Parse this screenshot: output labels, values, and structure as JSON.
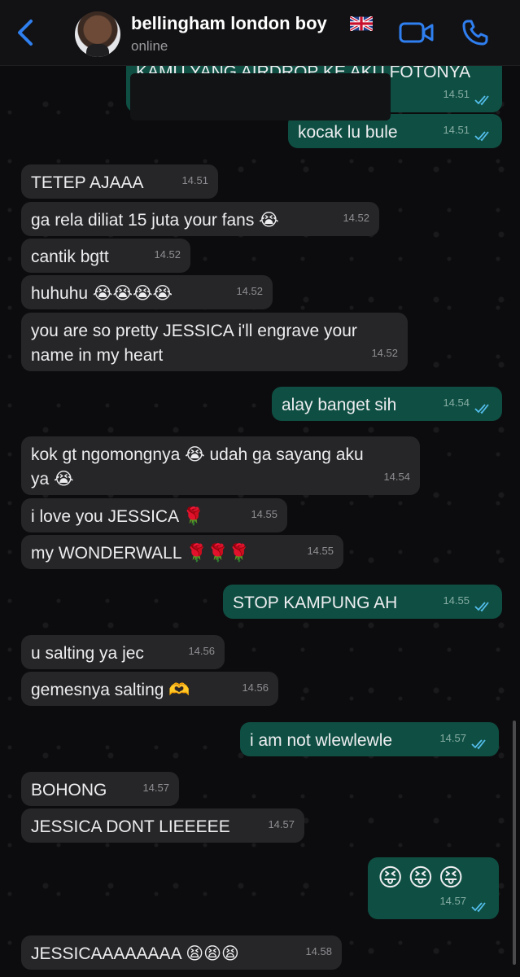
{
  "header": {
    "back_icon": "chevron-left-icon",
    "name": "bellingham london boy",
    "flag_icon": "uk-flag-icon",
    "status": "online",
    "video_icon": "video-camera-icon",
    "call_icon": "phone-icon"
  },
  "colors": {
    "incoming": "#262628",
    "outgoing": "#0f4f43",
    "accent": "#2f7ff0",
    "read_ticks": "#53bdeb"
  },
  "messages": [
    {
      "dir": "out",
      "text": "KAMU YANG AIRDROP KE AKU FOTONYA",
      "time": "14.51",
      "ticks": true
    },
    {
      "dir": "out",
      "text": "kocak lu bule",
      "time": "14.51",
      "ticks": true
    },
    {
      "dir": "in",
      "text": "TETEP AJAAA",
      "time": "14.51"
    },
    {
      "dir": "in",
      "text": "ga rela diliat 15 juta your fans 😭",
      "time": "14.52"
    },
    {
      "dir": "in",
      "text": "cantik bgtt",
      "time": "14.52"
    },
    {
      "dir": "in",
      "text": "huhuhu 😭😭😭😭",
      "time": "14.52"
    },
    {
      "dir": "in",
      "text": "you are so pretty JESSICA i'll engrave your\nname in my heart",
      "time": "14.52"
    },
    {
      "dir": "out",
      "text": "alay banget sih",
      "time": "14.54",
      "ticks": true
    },
    {
      "dir": "in",
      "text": "kok gt ngomongnya 😭 udah ga sayang aku\nya 😭",
      "time": "14.54"
    },
    {
      "dir": "in",
      "text": "i love you JESSICA 🌹",
      "time": "14.55"
    },
    {
      "dir": "in",
      "text": "my WONDERWALL 🌹🌹🌹",
      "time": "14.55"
    },
    {
      "dir": "out",
      "text": "STOP KAMPUNG AH",
      "time": "14.55",
      "ticks": true
    },
    {
      "dir": "in",
      "text": "u salting ya jec",
      "time": "14.56"
    },
    {
      "dir": "in",
      "text": "gemesnya salting 🫶",
      "time": "14.56"
    },
    {
      "dir": "out",
      "text": "i am not wlewlewle",
      "time": "14.57",
      "ticks": true
    },
    {
      "dir": "in",
      "text": "BOHONG",
      "time": "14.57"
    },
    {
      "dir": "in",
      "text": "JESSICA DONT LIEEEEE",
      "time": "14.57"
    },
    {
      "dir": "out",
      "text": "😝😝😝",
      "time": "14.57",
      "ticks": true
    },
    {
      "dir": "in",
      "text": "JESSICAAAAAAAA 😫😫😫",
      "time": "14.58"
    }
  ]
}
